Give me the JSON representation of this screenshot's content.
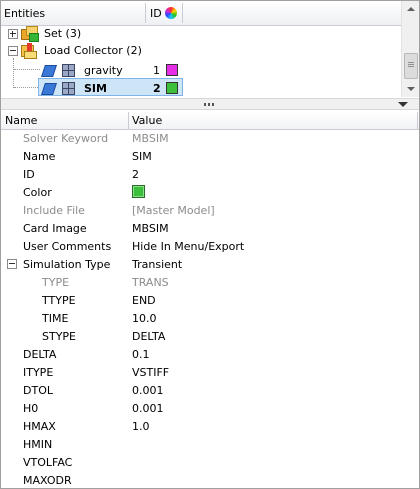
{
  "tree": {
    "header": {
      "entities_label": "Entities",
      "id_label": "ID"
    },
    "nodes": [
      {
        "label": "Set (3)",
        "expanded": false
      },
      {
        "label": "Load Collector (2)",
        "expanded": true
      }
    ],
    "load_collectors": [
      {
        "name": "gravity",
        "id": "1",
        "color": "#e62ee6",
        "selected": false
      },
      {
        "name": "SIM",
        "id": "2",
        "color": "#3cc03c",
        "selected": true
      }
    ]
  },
  "properties": {
    "header": {
      "name": "Name",
      "value": "Value"
    },
    "rows": [
      {
        "name": "Solver Keyword",
        "value": "MBSIM",
        "muted": true
      },
      {
        "name": "Name",
        "value": "SIM"
      },
      {
        "name": "ID",
        "value": "2"
      },
      {
        "name": "Color",
        "value": "",
        "swatch": "#3cc03c"
      },
      {
        "name": "Include File",
        "value": "[Master Model]",
        "muted": true
      },
      {
        "name": "Card Image",
        "value": "MBSIM"
      },
      {
        "name": "User Comments",
        "value": "Hide In Menu/Export"
      },
      {
        "name": "Simulation Type",
        "value": "Transient",
        "group": true
      },
      {
        "name": "TYPE",
        "value": "TRANS",
        "muted": true,
        "indent": true
      },
      {
        "name": "TTYPE",
        "value": "END",
        "indent": true
      },
      {
        "name": "TIME",
        "value": "10.0",
        "indent": true
      },
      {
        "name": "STYPE",
        "value": "DELTA",
        "indent": true
      },
      {
        "name": "DELTA",
        "value": "0.1"
      },
      {
        "name": "ITYPE",
        "value": "VSTIFF"
      },
      {
        "name": "DTOL",
        "value": "0.001"
      },
      {
        "name": "H0",
        "value": "0.001"
      },
      {
        "name": "HMAX",
        "value": "1.0"
      },
      {
        "name": "HMIN",
        "value": ""
      },
      {
        "name": "VTOLFAC",
        "value": ""
      },
      {
        "name": "MAXODR",
        "value": ""
      }
    ]
  }
}
